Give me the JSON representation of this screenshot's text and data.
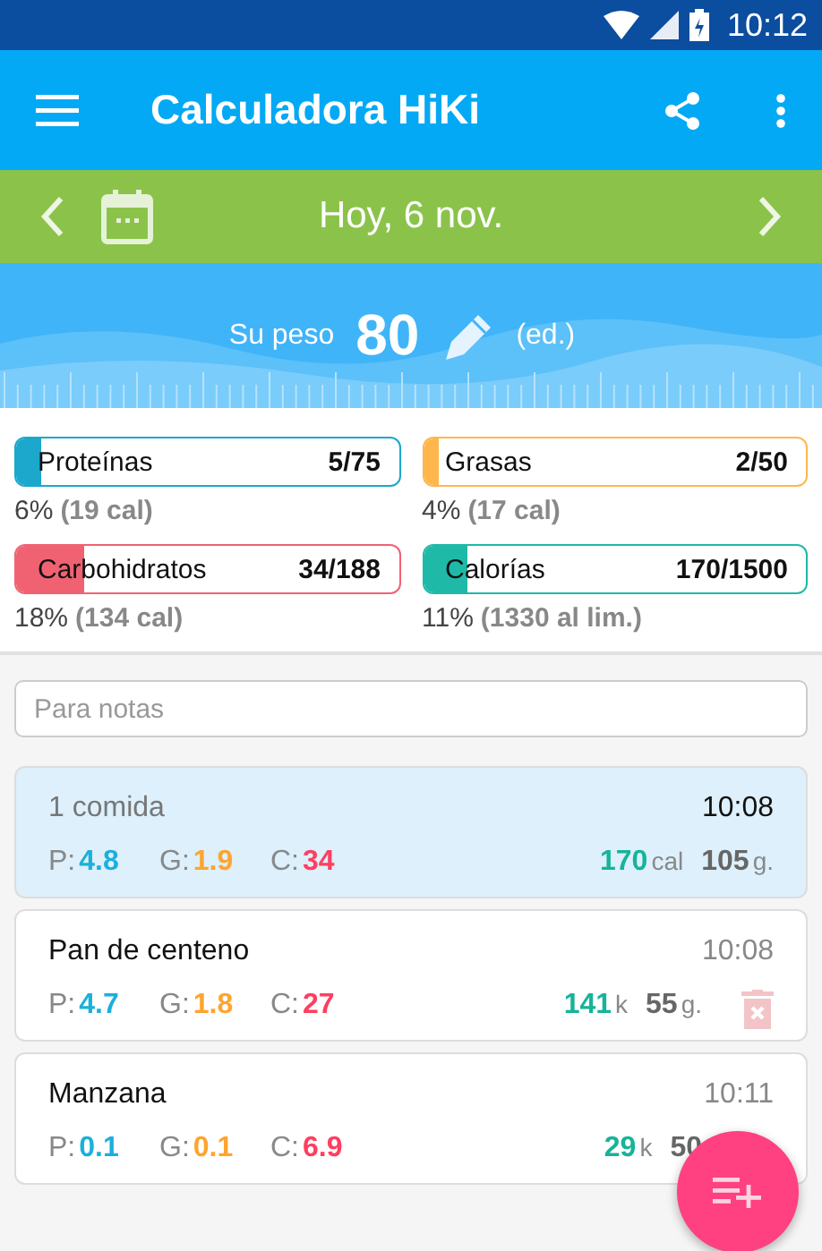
{
  "status_bar": {
    "time": "10:12"
  },
  "app_bar": {
    "title": "Calculadora HiKi"
  },
  "date_bar": {
    "label": "Hoy, 6 nov."
  },
  "weight": {
    "label": "Su peso",
    "value": "80",
    "note": "(ed.)"
  },
  "summary": [
    {
      "name": "Proteínas",
      "amount": "5/75",
      "level": 0.067,
      "color": "#1ba8cc",
      "percent": "6%",
      "detail": "(19 cal)"
    },
    {
      "name": "Grasas",
      "amount": "2/50",
      "level": 0.04,
      "color": "#ffb74d",
      "percent": "4%",
      "detail": "(17 cal)"
    },
    {
      "name": "Carbohidratos",
      "amount": "34/188",
      "level": 0.18,
      "color": "#f06272",
      "percent": "18%",
      "detail": "(134 cal)"
    },
    {
      "name": "Calorías",
      "amount": "170/1500",
      "level": 0.113,
      "color": "#1fb9a8",
      "percent": "11%",
      "detail": "(1330 al lim.)"
    }
  ],
  "notes": {
    "placeholder": "Para notas"
  },
  "meals": [
    {
      "kind": "total",
      "name": "1 comida",
      "time": "10:08",
      "p_label": "P:",
      "g_label": "G:",
      "c_label": "C:",
      "p": "4.8",
      "g": "1.9",
      "c": "34",
      "energy": "170",
      "energy_unit": "cal",
      "weight": "105",
      "weight_unit": "g.",
      "selected": true
    },
    {
      "kind": "item",
      "name": "Pan de centeno",
      "time": "10:08",
      "p_label": "P:",
      "g_label": "G:",
      "c_label": "C:",
      "p": "4.7",
      "g": "1.8",
      "c": "27",
      "energy": "141",
      "energy_unit": "k",
      "weight": "55",
      "weight_unit": "g.",
      "selected": false,
      "deletable": true
    },
    {
      "kind": "item",
      "name": "Manzana",
      "time": "10:11",
      "p_label": "P:",
      "g_label": "G:",
      "c_label": "C:",
      "p": "0.1",
      "g": "0.1",
      "c": "6.9",
      "energy": "29",
      "energy_unit": "k",
      "weight": "50",
      "selected": false
    }
  ]
}
